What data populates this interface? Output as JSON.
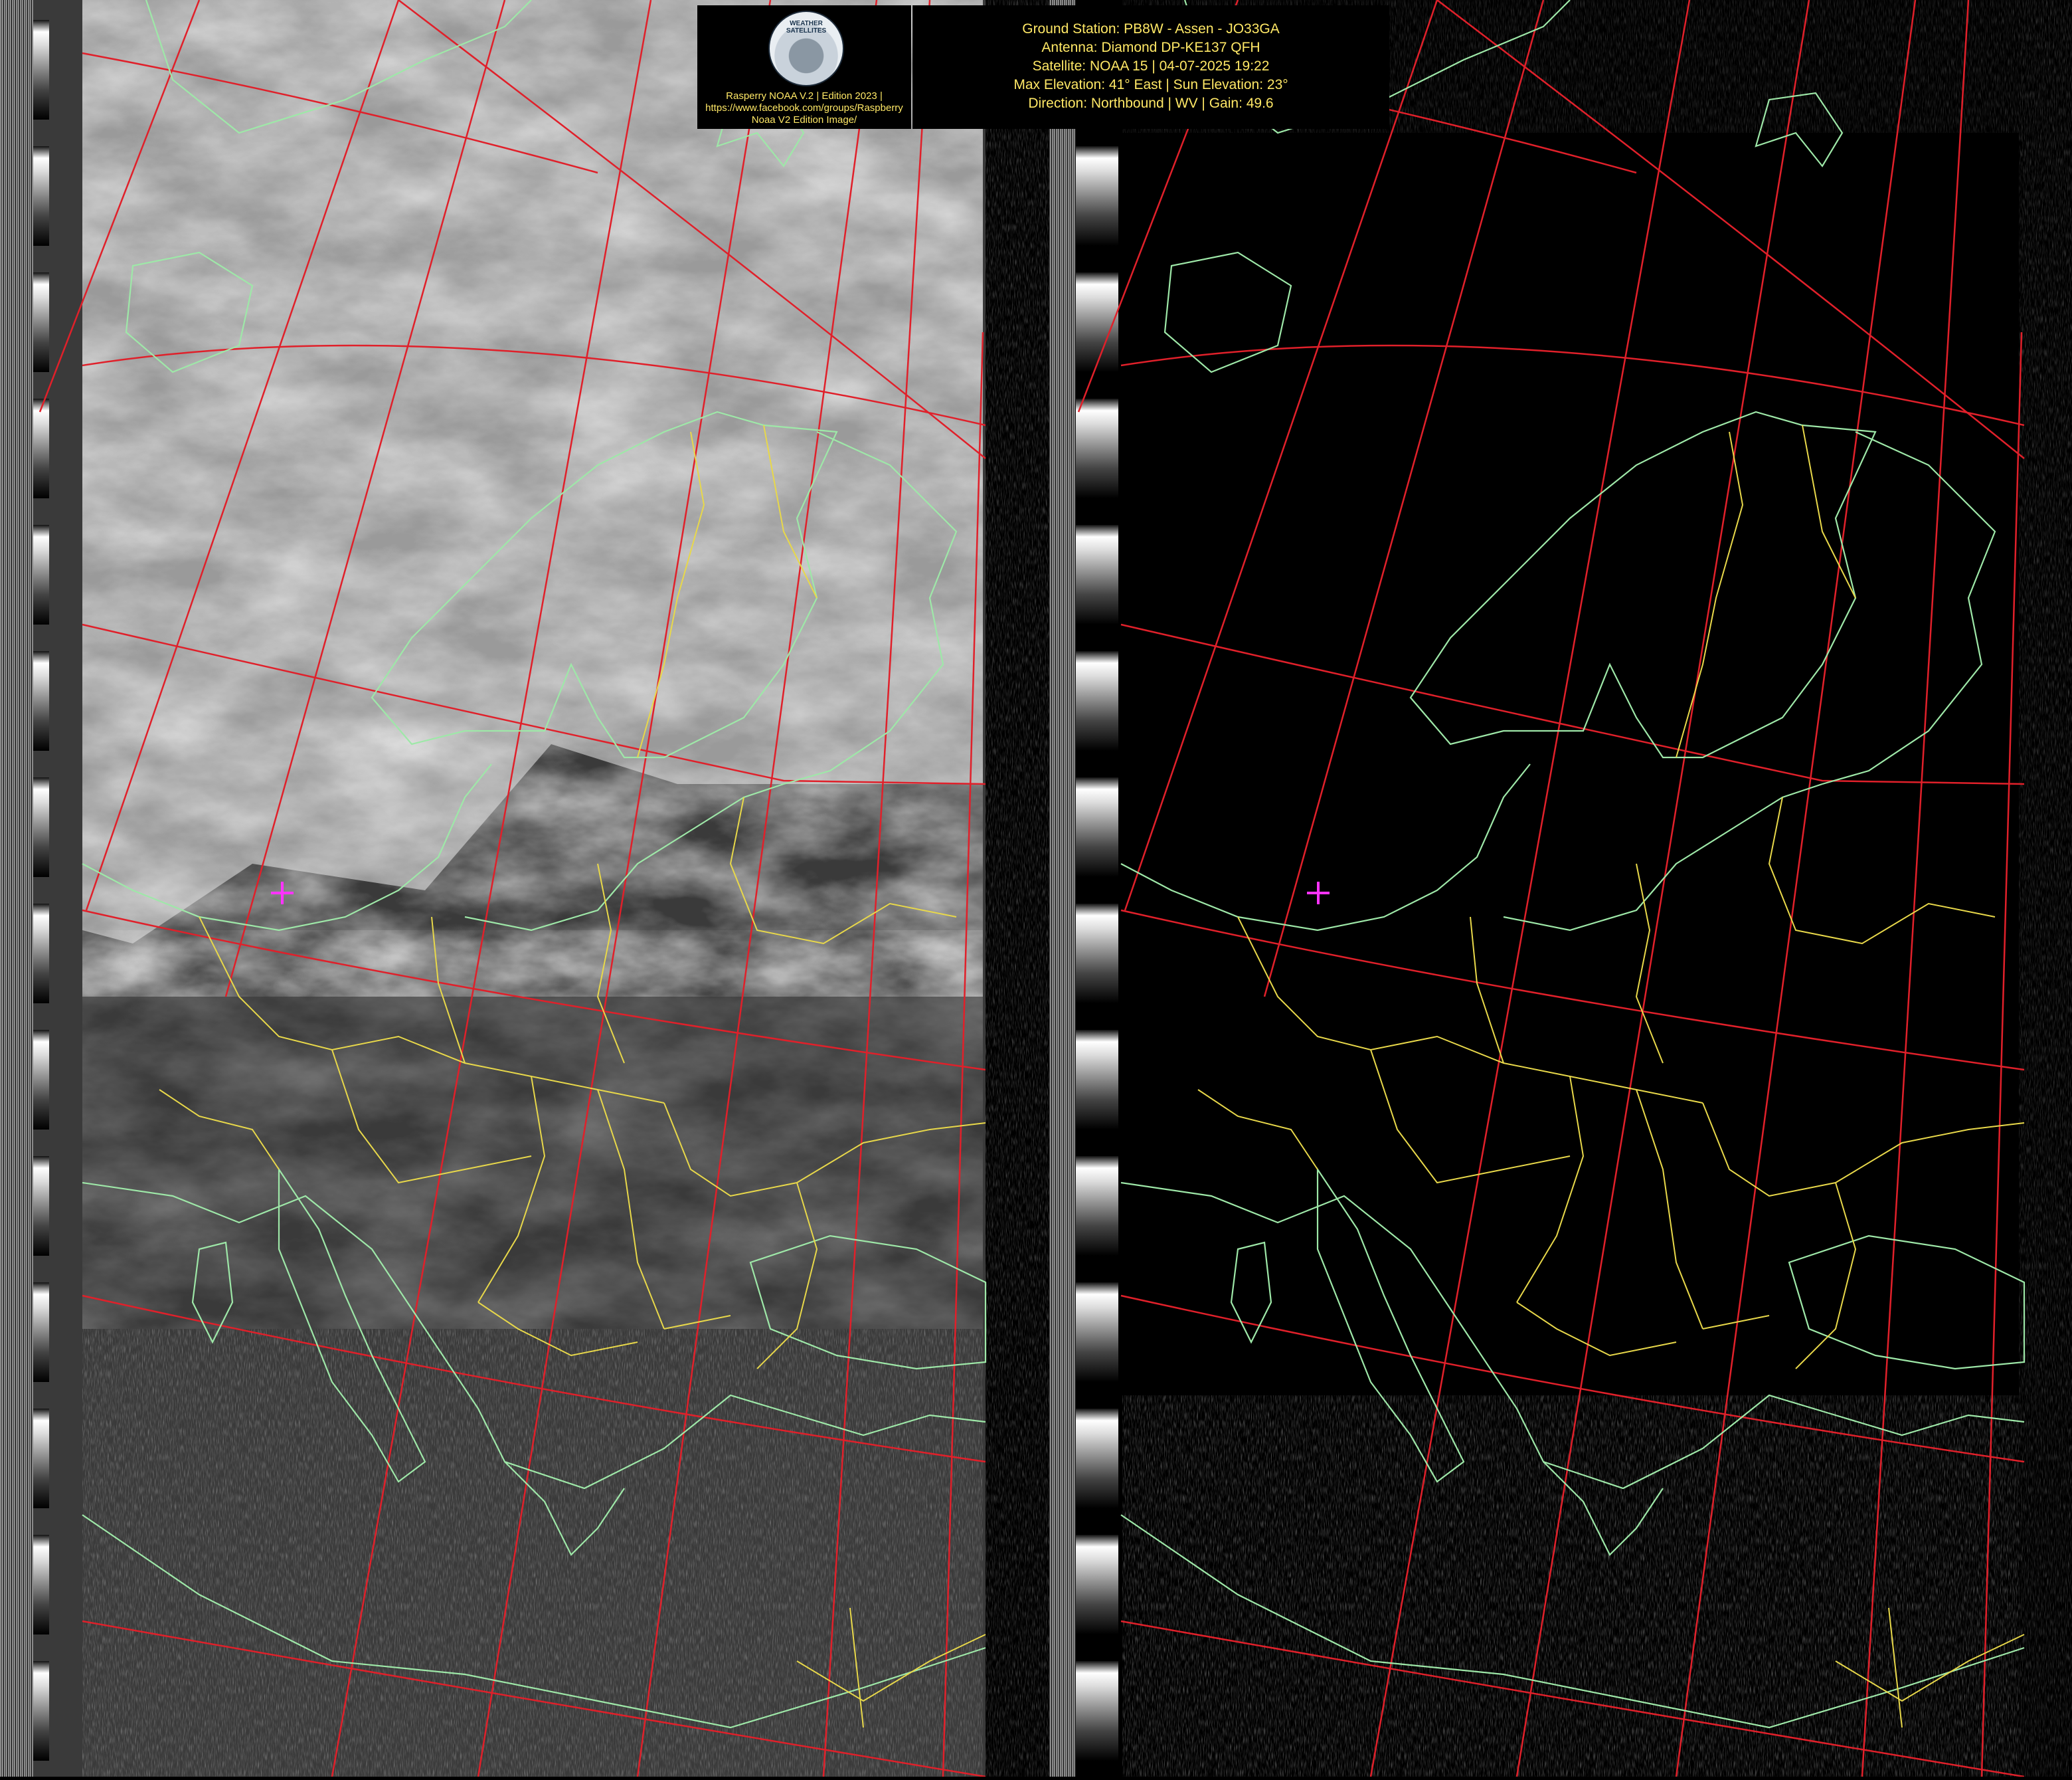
{
  "header": {
    "logo_badge_text": "WEATHER SATELLITES",
    "credit_lines": [
      "Rasperry NOAA V.2 | Edition 2023 |",
      "https://www.facebook.com/groups/Raspberry",
      "Noaa V2 Edition Image/"
    ],
    "station_lines": [
      "Ground Station: PB8W - Assen - JO33GA",
      "Antenna: Diamond DP-KE137 QFH",
      "Satellite: NOAA 15 | 04-07-2025 19:22",
      "Max Elevation: 41° East | Sun Elevation: 23°",
      "Direction: Northbound | WV | Gain: 49.6"
    ]
  },
  "colors": {
    "grid": "#e0202a",
    "coastline": "#9ee8a8",
    "borders": "#e8d84a",
    "station_marker": "#ff33ff",
    "header_text": "#ffe866"
  },
  "icons": {
    "station_marker": "plus-cross"
  }
}
